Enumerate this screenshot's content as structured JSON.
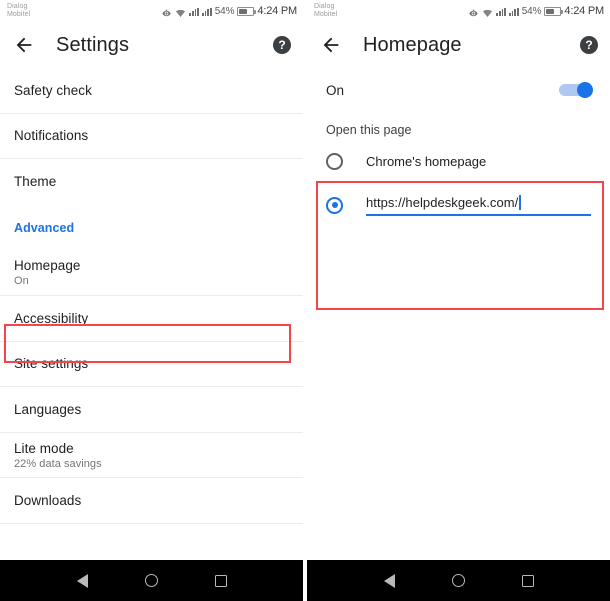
{
  "status_bar": {
    "carrier": "Dialog\nMobitel",
    "icons": [
      "eye-icon",
      "wifi-icon",
      "signal-icon-sim1",
      "signal-icon-sim2"
    ],
    "battery_percent": "54%",
    "time": "4:24 PM"
  },
  "colors": {
    "accent_blue": "#1a73e8",
    "highlight_red": "#f4464a",
    "text_primary": "#202124",
    "text_secondary": "#757575",
    "nav_bar_bg": "#000000"
  },
  "left_screen": {
    "appbar": {
      "back_label": "Back",
      "title": "Settings",
      "help_label": "?"
    },
    "rows": [
      {
        "title": "Safety check",
        "sub": ""
      },
      {
        "title": "Notifications",
        "sub": ""
      },
      {
        "title": "Theme",
        "sub": ""
      },
      {
        "title": "Advanced",
        "sub": ""
      },
      {
        "title": "Homepage",
        "sub": "On"
      },
      {
        "title": "Accessibility",
        "sub": ""
      },
      {
        "title": "Site settings",
        "sub": ""
      },
      {
        "title": "Languages",
        "sub": ""
      },
      {
        "title": "Lite mode",
        "sub": "22% data savings"
      },
      {
        "title": "Downloads",
        "sub": ""
      }
    ]
  },
  "right_screen": {
    "appbar": {
      "back_label": "Back",
      "title": "Homepage",
      "help_label": "?"
    },
    "toggle": {
      "label": "On",
      "state": "on"
    },
    "section": {
      "title": "Open this page",
      "options": [
        {
          "label": "Chrome's homepage",
          "selected": false
        },
        {
          "label": "",
          "selected": true
        }
      ],
      "url_value": "https://helpdeskgeek.com/"
    }
  },
  "nav_bar": {
    "back": "back-triangle-icon",
    "home": "home-circle-icon",
    "recents": "recents-square-icon"
  }
}
